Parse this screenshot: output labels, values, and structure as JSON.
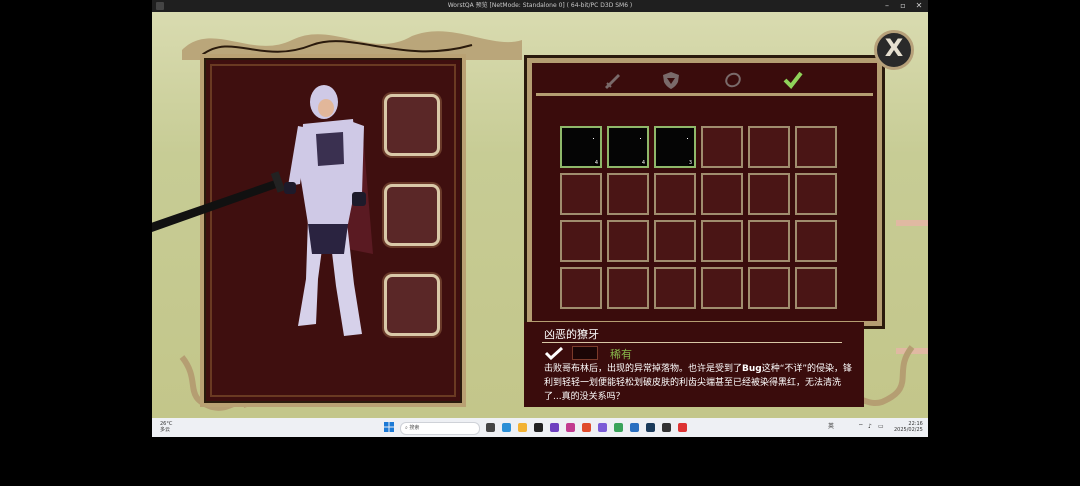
{
  "window": {
    "title": "WorstQA 预览 [NetMode: Standalone 0]  ( 64-bit/PC D3D SM6 )",
    "controls": [
      "minimize",
      "maximize",
      "close"
    ]
  },
  "game": {
    "close_label": "X",
    "tabs": [
      {
        "name": "weapon",
        "icon": "sword-icon",
        "active": false
      },
      {
        "name": "armor",
        "icon": "shield-icon",
        "active": false
      },
      {
        "name": "accessory",
        "icon": "necklace-icon",
        "active": false
      },
      {
        "name": "misc",
        "icon": "checkmark-icon",
        "active": true
      }
    ],
    "equip_slots": 3,
    "inventory": [
      {
        "filled": true,
        "qty": "4"
      },
      {
        "filled": true,
        "qty": "4"
      },
      {
        "filled": true,
        "qty": "3"
      },
      {
        "filled": false
      },
      {
        "filled": false
      },
      {
        "filled": false
      },
      {
        "filled": false
      },
      {
        "filled": false
      },
      {
        "filled": false
      },
      {
        "filled": false
      },
      {
        "filled": false
      },
      {
        "filled": false
      },
      {
        "filled": false
      },
      {
        "filled": false
      },
      {
        "filled": false
      },
      {
        "filled": false
      },
      {
        "filled": false
      },
      {
        "filled": false
      },
      {
        "filled": false
      },
      {
        "filled": false
      },
      {
        "filled": false
      },
      {
        "filled": false
      },
      {
        "filled": false
      },
      {
        "filled": false
      }
    ],
    "item": {
      "name": "凶恶的獠牙",
      "rarity": "稀有",
      "desc_1": "击败哥布林后，出现的异常掉落物。也许是受到了",
      "desc_bug": "Bug",
      "desc_2": "这种“不详”的侵染，锋利到轻轻一划便能轻松划破皮肤的利齿尖端甚至已经被染得黑红，无法清洗了...真的没关系吗？"
    },
    "colors": {
      "panel": "#3a0c0c",
      "frame": "#b59e72",
      "rarity": "#86b64a"
    }
  },
  "taskbar": {
    "weather_temp": "26°C",
    "weather_desc": "多云",
    "search_placeholder": "搜索",
    "tray_lang": "英",
    "time": "22:16",
    "date": "2025/02/25"
  }
}
